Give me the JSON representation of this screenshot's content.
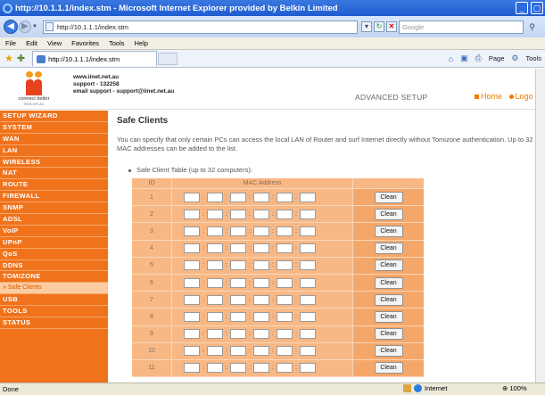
{
  "window": {
    "title": "http://10.1.1.1/index.stm - Microsoft Internet Explorer provided by Belkin Limited"
  },
  "address_bar": {
    "url": "http://10.1.1.1/index.stm",
    "search_placeholder": "Google"
  },
  "menu": [
    "File",
    "Edit",
    "View",
    "Favorites",
    "Tools",
    "Help"
  ],
  "tab": {
    "title": "http://10.1.1.1/index.stm"
  },
  "ie_toolbar": {
    "page_label": "Page",
    "tools_label": "Tools"
  },
  "header": {
    "logo_tagline": "connect better",
    "logo_url": "iinet.net.au",
    "website": "www.iinet.net.au",
    "support_phone": "support - 132258",
    "support_email": "email support - support@iinet.net.au",
    "section_label": "ADVANCED SETUP",
    "home_link": "Home",
    "logout_link": "Logo"
  },
  "sidebar": {
    "items": [
      "SETUP WIZARD",
      "SYSTEM",
      "WAN",
      "LAN",
      "WIRELESS",
      "NAT",
      "ROUTE",
      "FIREWALL",
      "SNMP",
      "ADSL",
      "VoIP",
      "UPnP",
      "QoS",
      "DDNS",
      "TOMIZONE",
      "» Safe Clients",
      "USB",
      "TOOLS",
      "STATUS"
    ],
    "active_item": "» Safe Clients"
  },
  "main": {
    "title": "Safe Clients",
    "description": "You can specify that only certain PCs can access the local LAN of Router and surf Internet directly without Tomizone authentication. Up to 32 MAC addresses can be added to the list.",
    "table_caption": "Safe Client Table (up to 32 computers):",
    "table": {
      "col_id": "ID",
      "col_mac": "MAC Address",
      "button_label": "Clean",
      "rows": [
        "1",
        "2",
        "3",
        "4",
        "5",
        "6",
        "7",
        "8",
        "9",
        "10",
        "11"
      ]
    }
  },
  "status_bar": {
    "status": "Done",
    "zone": "Internet",
    "zoom": "100%"
  },
  "colors": {
    "sidebar_bg": "#f0731c",
    "accent": "#ee7b00",
    "table_bg": "#f8b885"
  }
}
